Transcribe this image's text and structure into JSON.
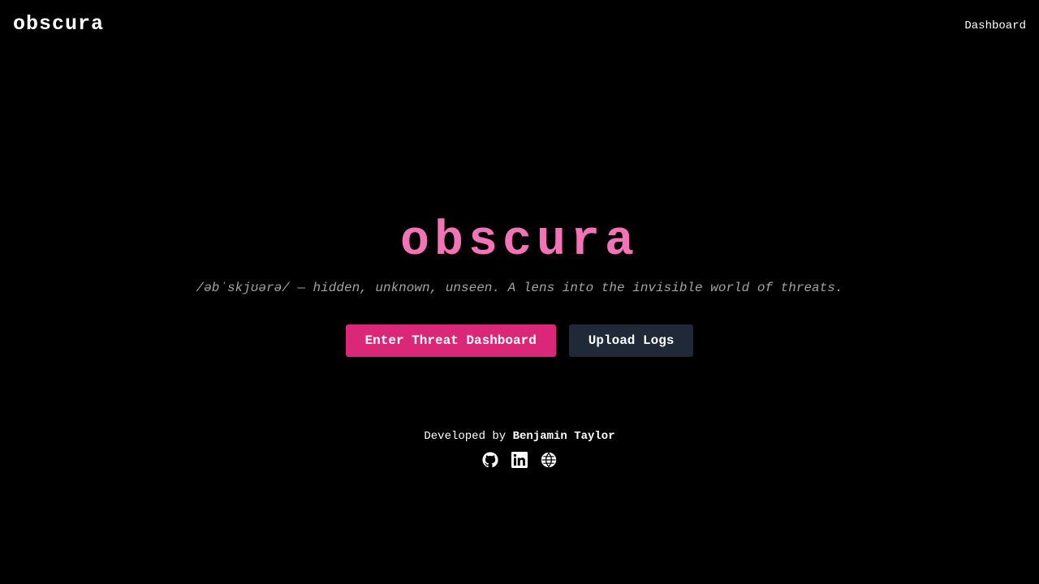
{
  "header": {
    "brand": "obscura",
    "nav_link": "Dashboard"
  },
  "hero": {
    "title": "obscura",
    "tagline": "/əbˈskjʊərə/ — hidden, unknown, unseen. A lens into the invisible world of threats.",
    "primary_button": "Enter Threat Dashboard",
    "secondary_button": "Upload Logs"
  },
  "footer": {
    "developed_by": "Developed by",
    "developer_name": "Benjamin Taylor",
    "social_icons": [
      "github-icon",
      "linkedin-icon",
      "globe-icon"
    ]
  },
  "colors": {
    "background": "#000000",
    "accent_pink": "#f472b6",
    "primary_button": "#db2777",
    "secondary_button": "#1f2937",
    "muted_text": "#a3a3a3"
  }
}
